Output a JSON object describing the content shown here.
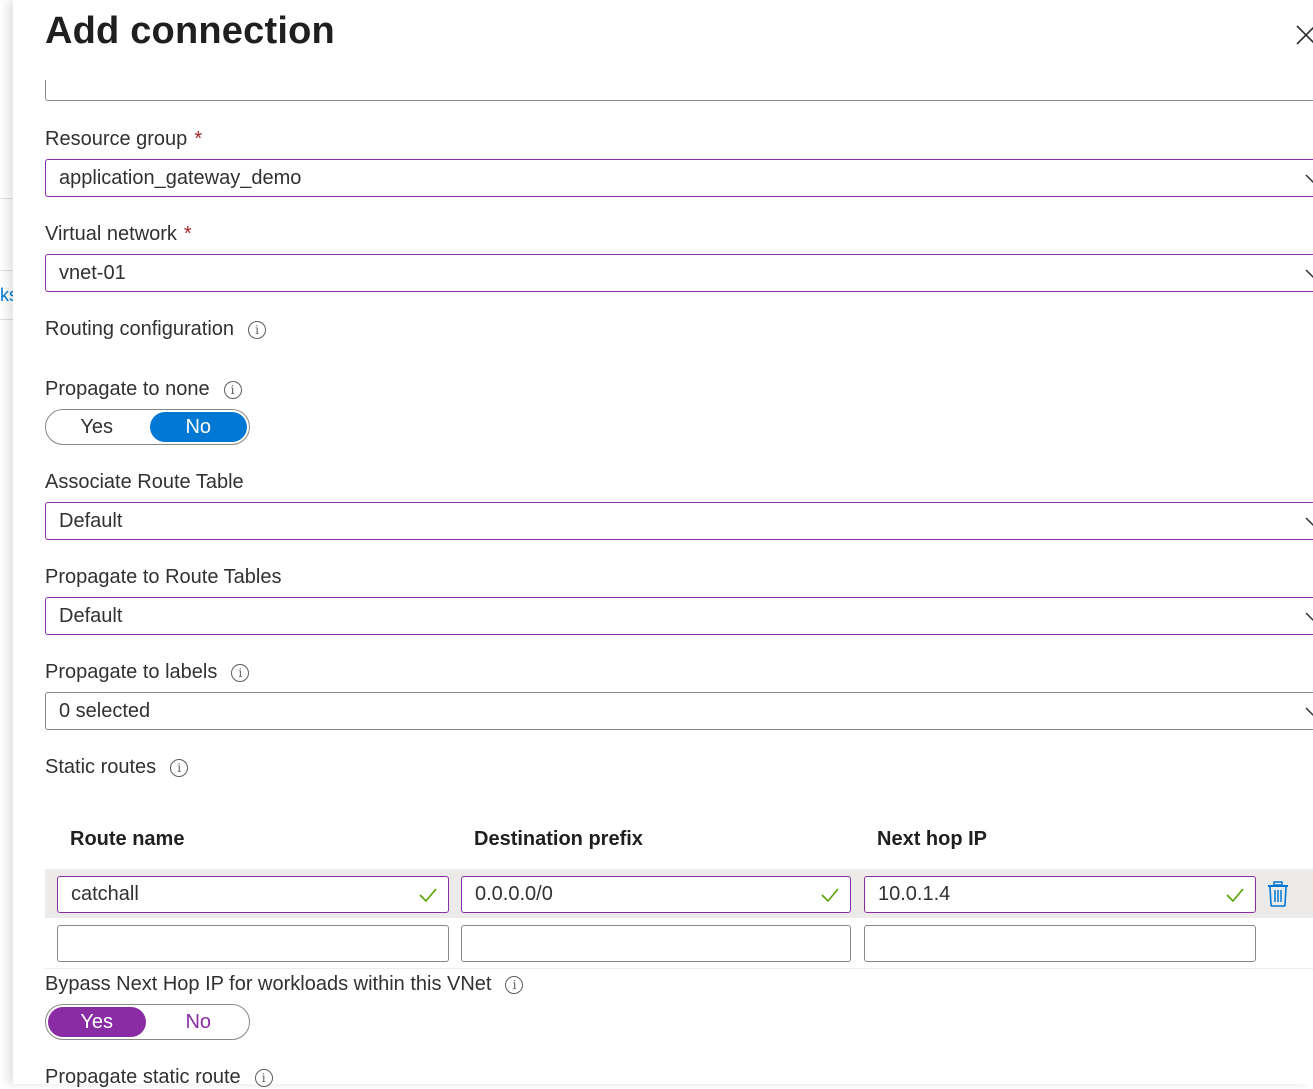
{
  "background": {
    "link_fragment": "ks"
  },
  "panel": {
    "title": "Add connection",
    "close_icon": "close-icon"
  },
  "fields": {
    "resource_group": {
      "label": "Resource group",
      "required_marker": "*",
      "value": "application_gateway_demo"
    },
    "virtual_network": {
      "label": "Virtual network",
      "required_marker": "*",
      "value": "vnet-01"
    },
    "routing_configuration": {
      "label": "Routing configuration",
      "info_icon": "ⓘ"
    },
    "propagate_to_none": {
      "label": "Propagate to none",
      "info_icon": "ⓘ",
      "options": [
        "Yes",
        "No"
      ],
      "selected": "No"
    },
    "associate_route_table": {
      "label": "Associate Route Table",
      "value": "Default"
    },
    "propagate_to_route_tables": {
      "label": "Propagate to Route Tables",
      "value": "Default"
    },
    "propagate_to_labels": {
      "label": "Propagate to labels",
      "info_icon": "ⓘ",
      "value": "0 selected"
    },
    "static_routes": {
      "label": "Static routes",
      "info_icon": "ⓘ",
      "columns": [
        "Route name",
        "Destination prefix",
        "Next hop IP"
      ],
      "rows": [
        {
          "route_name": "catchall",
          "destination_prefix": "0.0.0.0/0",
          "next_hop_ip": "10.0.1.4",
          "valid": true
        },
        {
          "route_name": "",
          "destination_prefix": "",
          "next_hop_ip": "",
          "valid": false
        }
      ]
    },
    "bypass_next_hop": {
      "label": "Bypass Next Hop IP for workloads within this VNet",
      "info_icon": "ⓘ",
      "options": [
        "Yes",
        "No"
      ],
      "selected": "Yes"
    },
    "propagate_static_route": {
      "label": "Propagate static route",
      "info_icon": "ⓘ"
    }
  },
  "colors": {
    "accent_purple": "#8a2da5",
    "toggle_blue": "#0078d4",
    "valid_green": "#57a300",
    "required_red": "#a4262c",
    "delete_blue": "#0078d4"
  }
}
